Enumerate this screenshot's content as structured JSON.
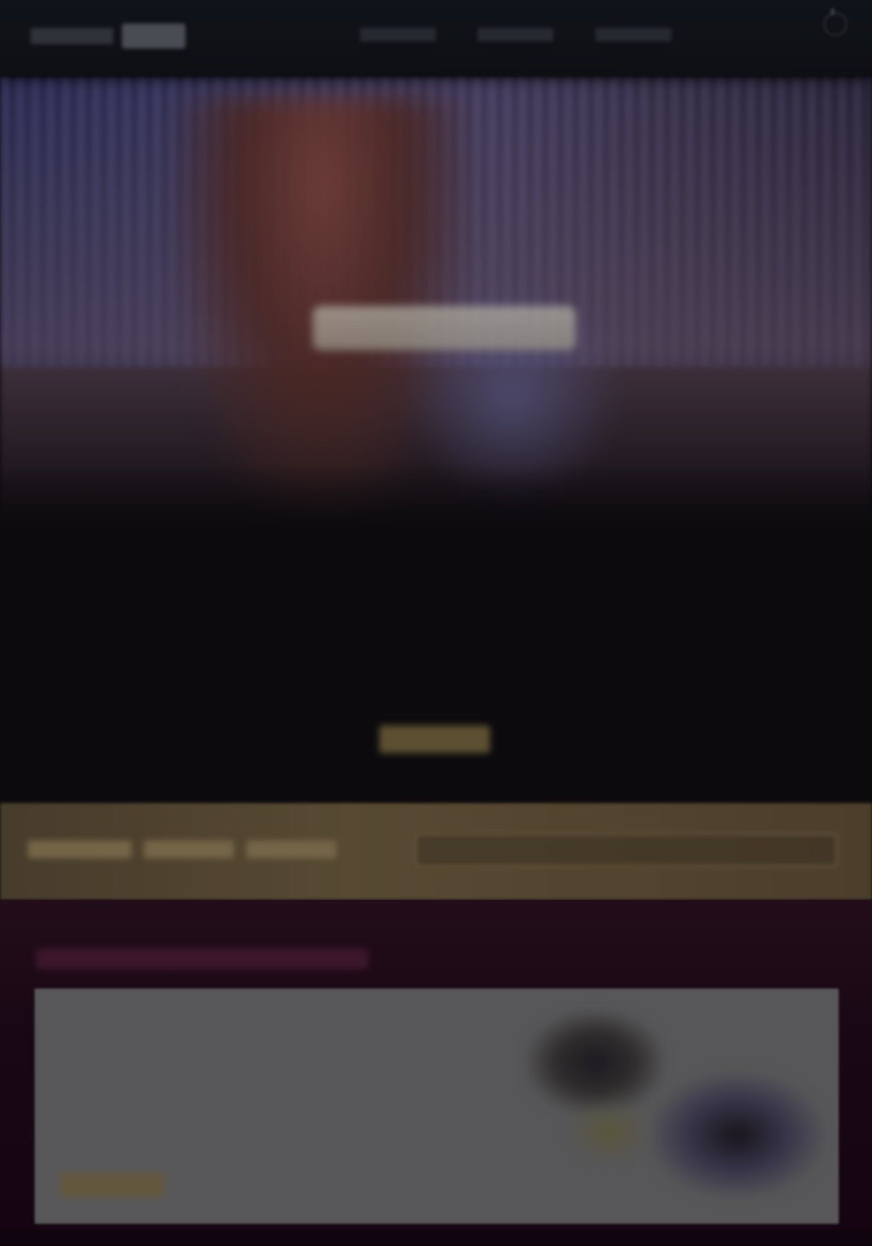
{
  "header": {
    "logo_text": "",
    "nav": [
      "",
      "",
      ""
    ],
    "menu_icon": "menu-icon"
  },
  "hero": {
    "title": "",
    "heading": "",
    "copy": "",
    "button_label": ""
  },
  "band": {
    "input_placeholder": ""
  },
  "featured": {
    "heading": "",
    "card_title": "",
    "card_copy": "",
    "card_button_label": ""
  },
  "colors": {
    "background": "#0c0a0e",
    "accent_gold": "#8a7748",
    "band": "#6b5a3e",
    "section": "#20091a",
    "card": "#6b6b6d"
  }
}
